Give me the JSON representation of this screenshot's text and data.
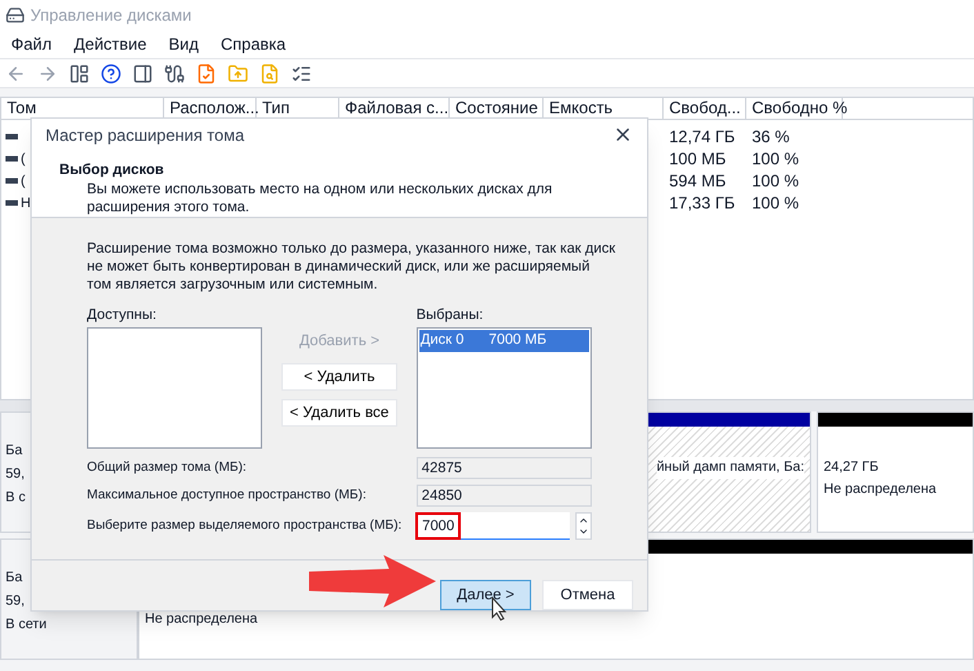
{
  "window": {
    "title": "Управление дисками"
  },
  "menu": [
    "Файл",
    "Действие",
    "Вид",
    "Справка"
  ],
  "table": {
    "columns": [
      "Том",
      "Располож...",
      "Тип",
      "Файловая с...",
      "Состояние",
      "Емкость",
      "Свобод...",
      "Свободно %"
    ],
    "rows": [
      {
        "volume": "",
        "free": "12,74 ГБ",
        "free_percent": "36 %"
      },
      {
        "volume": "(",
        "free": "100 МБ",
        "free_percent": "100 %"
      },
      {
        "volume": "(",
        "free": "594 МБ",
        "free_percent": "100 %"
      },
      {
        "volume": "Н",
        "free": "17,33 ГБ",
        "free_percent": "100 %"
      }
    ]
  },
  "disks": [
    {
      "info": [
        "Ба",
        "59,",
        "В с"
      ],
      "partitions": [
        {
          "kind": "primary",
          "selected": true,
          "text": [
            "йный дамп памяти, Ба:"
          ]
        },
        {
          "kind": "unallocated",
          "selected": false,
          "text": [
            "24,27 ГБ",
            "Не распределена"
          ]
        }
      ]
    },
    {
      "info": [
        "Ба",
        "59,",
        "В сети"
      ],
      "partitions": [
        {
          "kind": "unallocated",
          "selected": false,
          "text": [
            "Не распределена"
          ]
        }
      ]
    }
  ],
  "dialog": {
    "title": "Мастер расширения тома",
    "heading": "Выбор дисков",
    "subheading": "Вы можете использовать место на одном или нескольких дисках для расширения этого тома.",
    "description": "Расширение тома возможно только до размера, указанного ниже, так как диск не может быть конвертирован в динамический диск, или же расширяемый том является загрузочным или системным.",
    "available_label": "Доступны:",
    "selected_label": "Выбраны:",
    "selected_items": [
      {
        "disk": "Диск 0",
        "size": "7000 МБ",
        "selected": true
      }
    ],
    "list_buttons": [
      {
        "label": "Добавить >",
        "disabled": true
      },
      {
        "label": "< Удалить",
        "disabled": false
      },
      {
        "label": "< Удалить все",
        "disabled": false
      }
    ],
    "fields": [
      {
        "label": "Общий размер тома (МБ):",
        "value": "42875",
        "kind": "readonly",
        "highlighted": false
      },
      {
        "label": "Максимальное доступное пространство (МБ):",
        "value": "24850",
        "kind": "readonly",
        "highlighted": false
      },
      {
        "label": "Выберите размер выделяемого пространства (МБ):",
        "value": "7000",
        "kind": "spin",
        "highlighted": true
      }
    ],
    "buttons": [
      {
        "label": "Далее >",
        "kind": "primary"
      },
      {
        "label": "Отмена",
        "kind": "normal"
      }
    ]
  }
}
